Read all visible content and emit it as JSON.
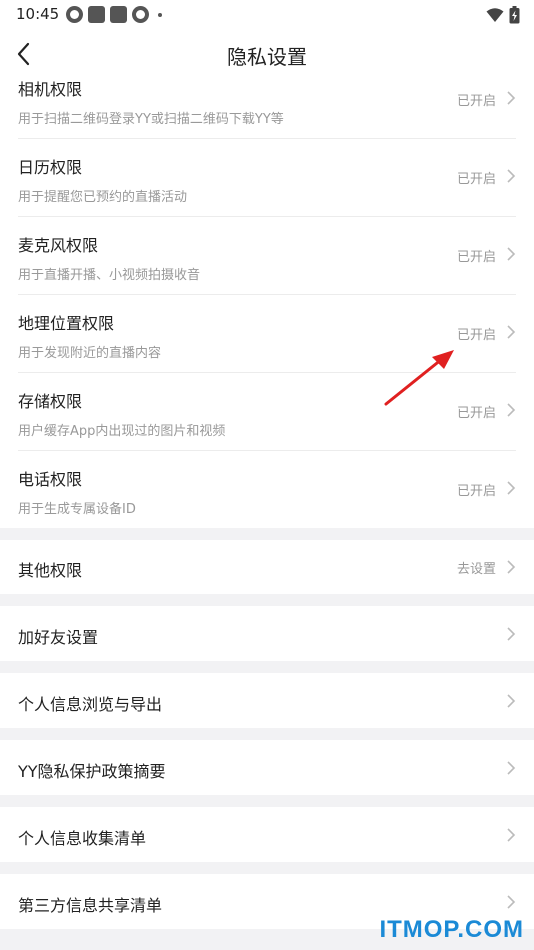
{
  "status_bar": {
    "time": "10:45",
    "icons": [
      "app-circle-icon",
      "app-square-icon",
      "app-square-icon",
      "app-circle-icon",
      "more-dot-icon",
      "wifi-icon",
      "battery-icon"
    ]
  },
  "nav": {
    "title": "隐私设置",
    "back_icon": "back-chevron-icon"
  },
  "permissions": [
    {
      "title": "相机权限",
      "desc": "用于扫描二维码登录YY或扫描二维码下载YY等",
      "status": "已开启"
    },
    {
      "title": "日历权限",
      "desc": "用于提醒您已预约的直播活动",
      "status": "已开启"
    },
    {
      "title": "麦克风权限",
      "desc": "用于直播开播、小视频拍摄收音",
      "status": "已开启"
    },
    {
      "title": "地理位置权限",
      "desc": "用于发现附近的直播内容",
      "status": "已开启"
    },
    {
      "title": "存储权限",
      "desc": "用户缓存App内出现过的图片和视频",
      "status": "已开启"
    },
    {
      "title": "电话权限",
      "desc": "用于生成专属设备ID",
      "status": "已开启"
    }
  ],
  "other_permissions": {
    "title": "其他权限",
    "status": "去设置"
  },
  "menu_items": [
    {
      "title": "加好友设置"
    },
    {
      "title": "个人信息浏览与导出"
    },
    {
      "title": "YY隐私保护政策摘要"
    },
    {
      "title": "个人信息收集清单"
    },
    {
      "title": "第三方信息共享清单"
    }
  ],
  "colors": {
    "background": "#f2f2f4",
    "card": "#ffffff",
    "annotation_arrow": "#e02020",
    "watermark": "#1b8ad6"
  },
  "watermark": "ITMOP.COM"
}
